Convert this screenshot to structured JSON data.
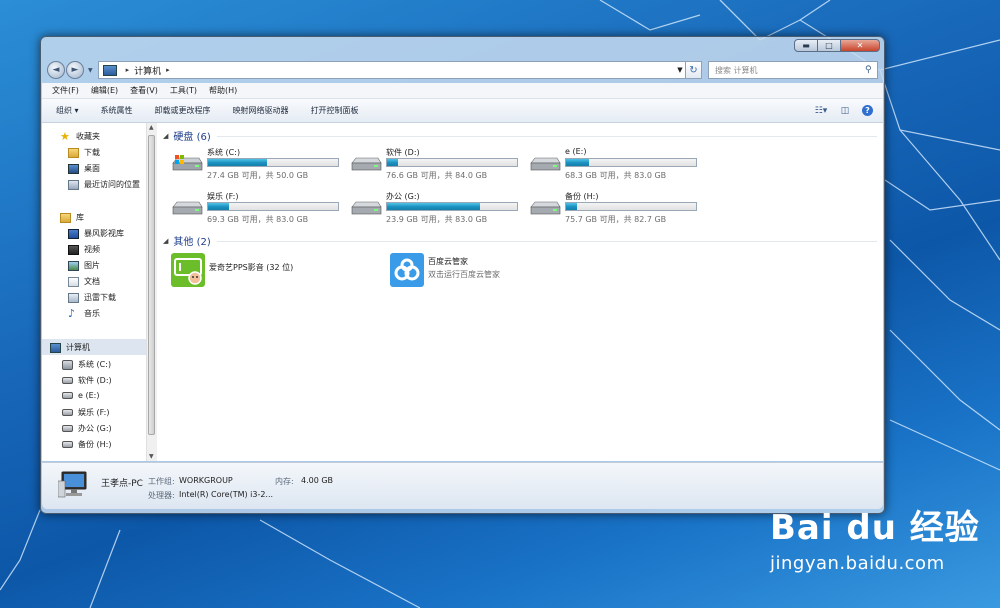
{
  "window": {
    "caption_buttons": {
      "minimize": "▬",
      "maximize": "□",
      "close": "✕"
    }
  },
  "navbar": {
    "back_icon": "◄",
    "forward_icon": "►",
    "address_path": "计算机",
    "refresh_icon": "↻",
    "search_placeholder": "搜索 计算机",
    "search_icon": "⚲"
  },
  "menu": {
    "items": [
      "文件(F)",
      "编辑(E)",
      "查看(V)",
      "工具(T)",
      "帮助(H)"
    ]
  },
  "toolbar": {
    "organize": "组织 ▾",
    "system_properties": "系统属性",
    "uninstall": "卸载或更改程序",
    "map_drive": "映射网络驱动器",
    "control_panel": "打开控制面板",
    "help_label": "?"
  },
  "sidebar": {
    "favorites": {
      "label": "收藏夹",
      "items": [
        "下载",
        "桌面",
        "最近访问的位置"
      ]
    },
    "libraries": {
      "label": "库",
      "items": [
        "暴风影视库",
        "视频",
        "图片",
        "文档",
        "迅雷下载",
        "音乐"
      ]
    },
    "computer": {
      "label": "计算机",
      "items": [
        "系统 (C:)",
        "软件 (D:)",
        "e (E:)",
        "娱乐 (F:)",
        "办公 (G:)",
        "备份 (H:)"
      ]
    }
  },
  "content": {
    "hard_disks_header": "硬盘 (6)",
    "other_header": "其他 (2)",
    "drives": [
      {
        "name": "系统 (C:)",
        "info": "27.4 GB 可用，共 50.0 GB",
        "used_fraction": 0.452
      },
      {
        "name": "软件 (D:)",
        "info": "76.6 GB 可用，共 84.0 GB",
        "used_fraction": 0.088
      },
      {
        "name": "e (E:)",
        "info": "68.3 GB 可用，共 83.0 GB",
        "used_fraction": 0.177
      },
      {
        "name": "娱乐 (F:)",
        "info": "69.3 GB 可用，共 83.0 GB",
        "used_fraction": 0.165
      },
      {
        "name": "办公 (G:)",
        "info": "23.9 GB 可用，共 83.0 GB",
        "used_fraction": 0.712
      },
      {
        "name": "备份 (H:)",
        "info": "75.7 GB 可用，共 82.7 GB",
        "used_fraction": 0.085
      }
    ],
    "apps": [
      {
        "name": "爱奇艺PPS影音 (32 位)",
        "desc": ""
      },
      {
        "name": "百度云管家",
        "desc": "双击运行百度云管家"
      }
    ]
  },
  "status": {
    "pc_name": "王孝点-PC",
    "workgroup_label": "工作组:",
    "workgroup_value": "WORKGROUP",
    "memory_label": "内存:",
    "memory_value": "4.00 GB",
    "cpu_label": "处理器:",
    "cpu_value": "Intel(R) Core(TM) i3-2..."
  },
  "watermark": {
    "logo": "Bai du 经验",
    "url": "jingyan.baidu.com"
  }
}
